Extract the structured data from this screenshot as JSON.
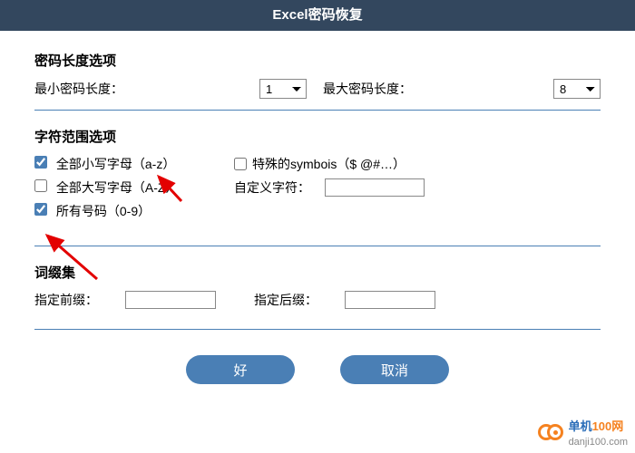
{
  "title": "Excel密码恢复",
  "sections": {
    "length": {
      "title": "密码长度选项",
      "min_label": "最小密码长度：",
      "min_value": "1",
      "max_label": "最大密码长度：",
      "max_value": "8"
    },
    "charset": {
      "title": "字符范围选项",
      "lowercase": {
        "label": "全部小写字母（a-z）",
        "checked": true
      },
      "uppercase": {
        "label": "全部大写字母（A-Z）",
        "checked": false
      },
      "digits": {
        "label": "所有号码（0-9）",
        "checked": true
      },
      "symbols": {
        "label": "特殊的symbois（$ @#…）",
        "checked": false
      },
      "custom_label": "自定义字符：",
      "custom_value": ""
    },
    "affix": {
      "title": "词缀集",
      "prefix_label": "指定前缀：",
      "prefix_value": "",
      "suffix_label": "指定后缀：",
      "suffix_value": ""
    }
  },
  "buttons": {
    "ok": "好",
    "cancel": "取消"
  },
  "watermark": {
    "brand1": "单机",
    "brand2": "100网",
    "url": "danji100.com"
  }
}
